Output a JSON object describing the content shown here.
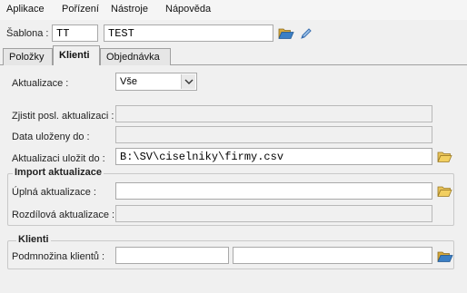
{
  "menu": [
    "Aplikace",
    "Pořízení",
    "Nástroje",
    "Nápověda"
  ],
  "sablona": {
    "label": "Šablona :",
    "code": "TT",
    "name": "TEST"
  },
  "tabs": [
    "Položky",
    "Klienti",
    "Objednávka"
  ],
  "aktualizace": {
    "label": "Aktualizace :",
    "value": "Vše"
  },
  "fields": {
    "zjistit": {
      "label": "Zjistit posl. aktualizaci :",
      "value": ""
    },
    "data_ulozeny": {
      "label": "Data uloženy do :",
      "value": ""
    },
    "ulozit_do": {
      "label": "Aktualizaci uložit do :",
      "value": "B:\\SV\\ciselniky\\firmy.csv"
    }
  },
  "import_group": {
    "title": "Import aktualizace",
    "uplna": {
      "label": "Úplná aktualizace :",
      "value": ""
    },
    "rozdilova": {
      "label": "Rozdílová aktualizace :",
      "value": ""
    }
  },
  "klienti_group": {
    "title": "Klienti",
    "podmnozina": {
      "label": "Podmnožina klientů :",
      "value1": "",
      "value2": ""
    }
  },
  "colors": {
    "folder": "#e8b93a",
    "folder_blue": "#3b7fc4",
    "pencil": "#3a6fb0"
  }
}
